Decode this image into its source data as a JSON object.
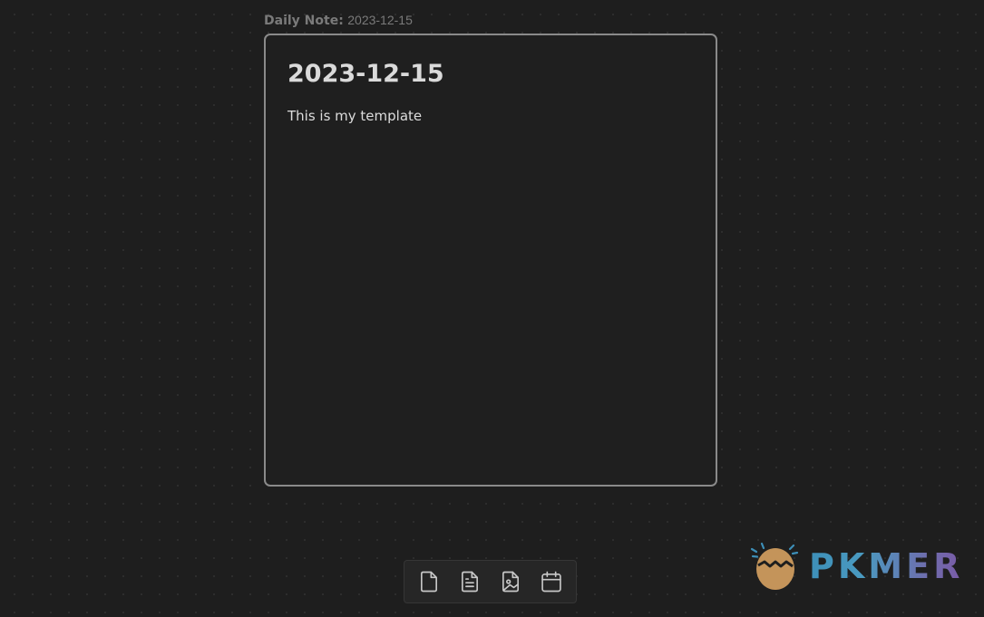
{
  "node": {
    "label_key": "Daily Note:",
    "label_value": "2023-12-15",
    "heading": "2023-12-15",
    "body": "This is my template"
  },
  "toolbar": {
    "items": [
      {
        "icon": "file-icon",
        "name": "new-note-button"
      },
      {
        "icon": "file-text-icon",
        "name": "add-note-from-vault-button"
      },
      {
        "icon": "file-image-icon",
        "name": "add-media-button"
      },
      {
        "icon": "calendar-icon",
        "name": "add-daily-note-button"
      }
    ]
  },
  "brand": {
    "name": "PKMER",
    "colors": {
      "start": "#3d8fb8",
      "end": "#7a5aa6",
      "egg": "#c4945a"
    }
  },
  "colors": {
    "background": "#1e1e1e",
    "card_border": "#8a8a8a",
    "text": "#dcdcdc",
    "label": "#7a7a7a"
  }
}
